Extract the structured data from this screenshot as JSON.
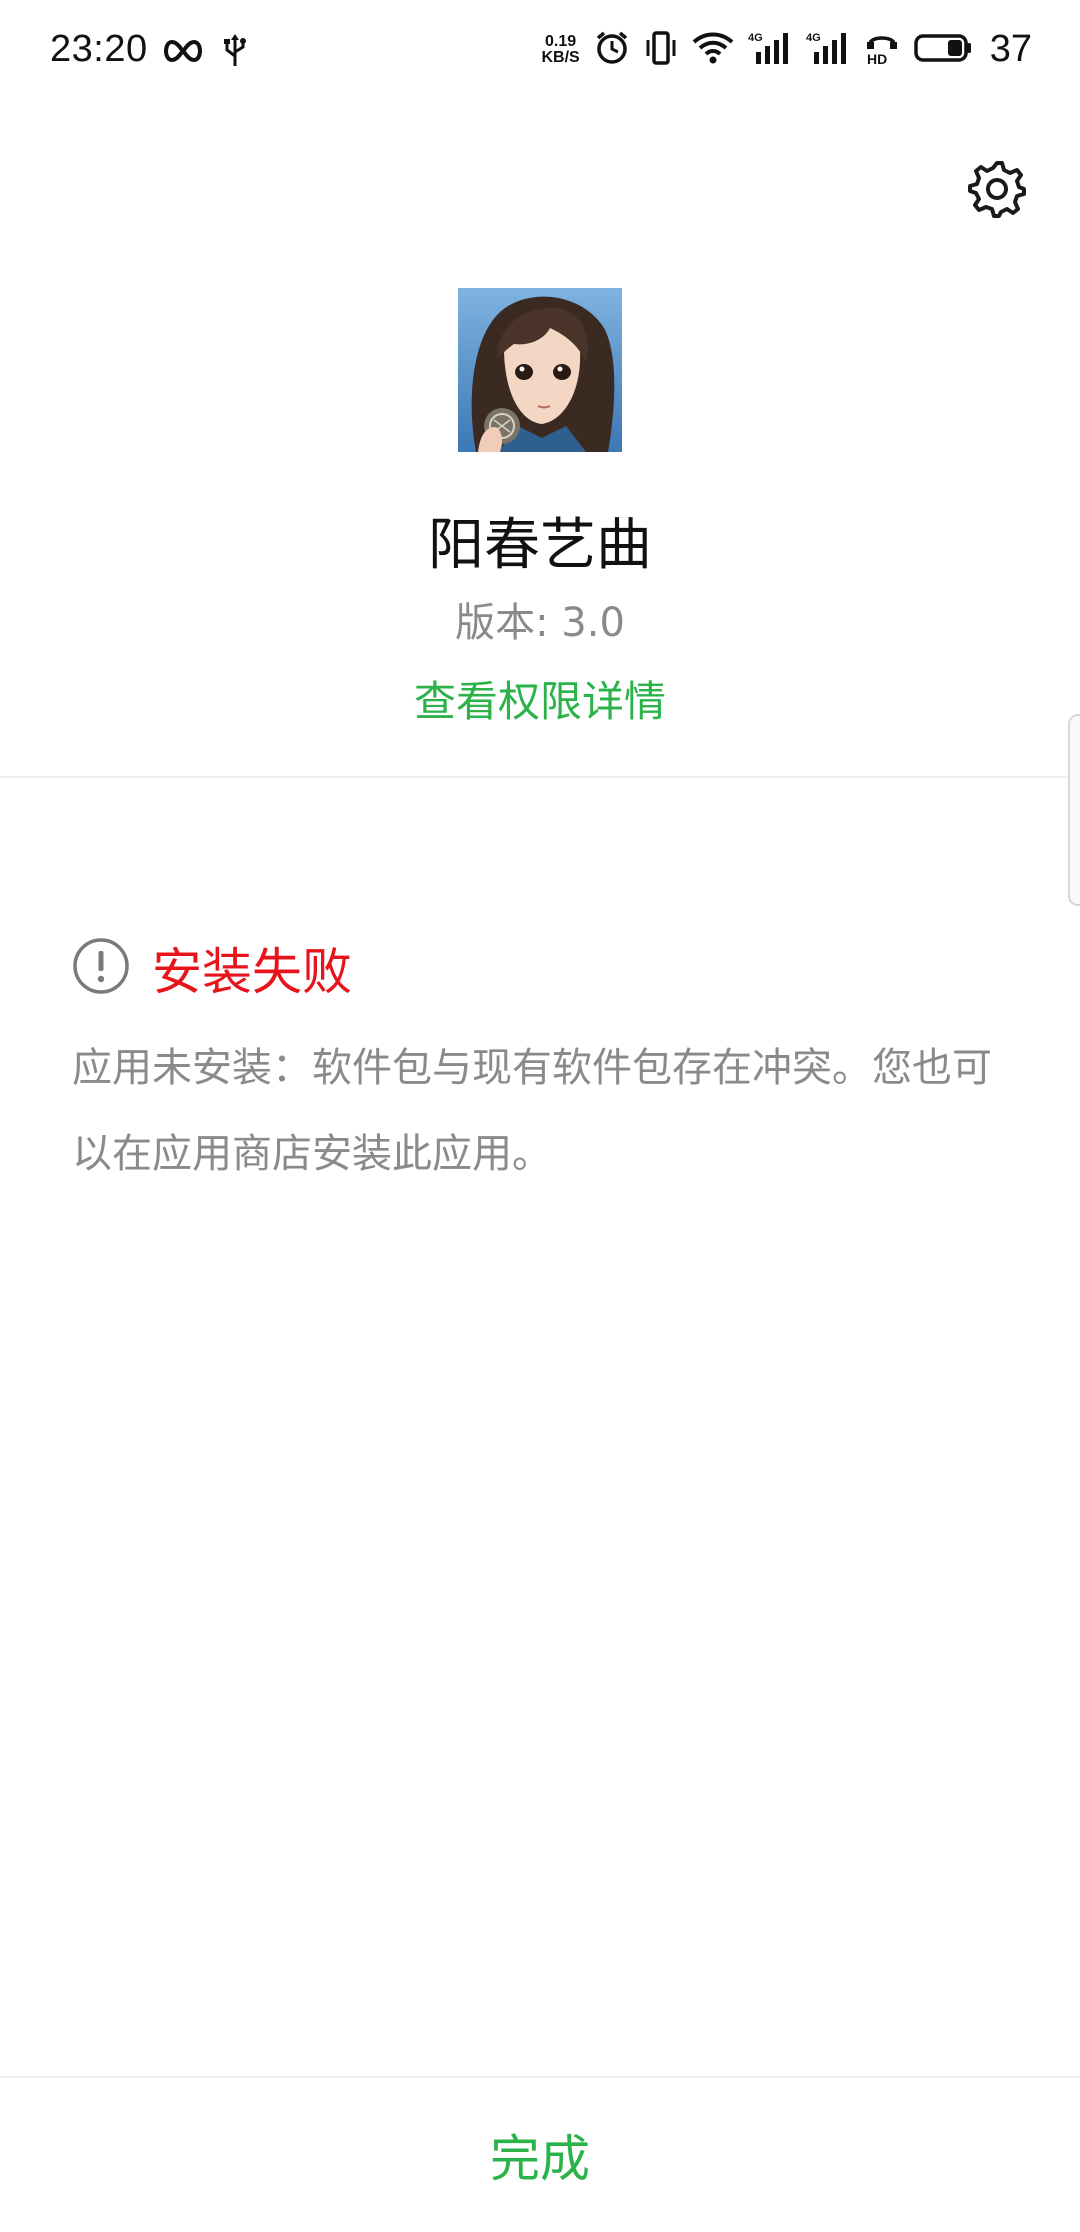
{
  "status_bar": {
    "time": "23:20",
    "net_speed_value": "0.19",
    "net_speed_unit": "KB/S",
    "battery_level": "37",
    "icons": [
      "infinity-icon",
      "usb-icon",
      "alarm-icon",
      "vibrate-icon",
      "wifi-icon",
      "signal-4g-icon",
      "signal-4g-icon",
      "hd-call-icon",
      "battery-icon"
    ]
  },
  "app": {
    "name": "阳春艺曲",
    "version": "版本: 3.0",
    "permissions_link": "查看权限详情"
  },
  "install_result": {
    "title": "安装失败",
    "message": "应用未安装：软件包与现有软件包存在冲突。您也可以在应用商店安装此应用。"
  },
  "actions": {
    "done_label": "完成"
  },
  "colors": {
    "accent_green": "#2bb34a",
    "error_red": "#e8141b",
    "secondary_text": "#8a8a8a"
  }
}
